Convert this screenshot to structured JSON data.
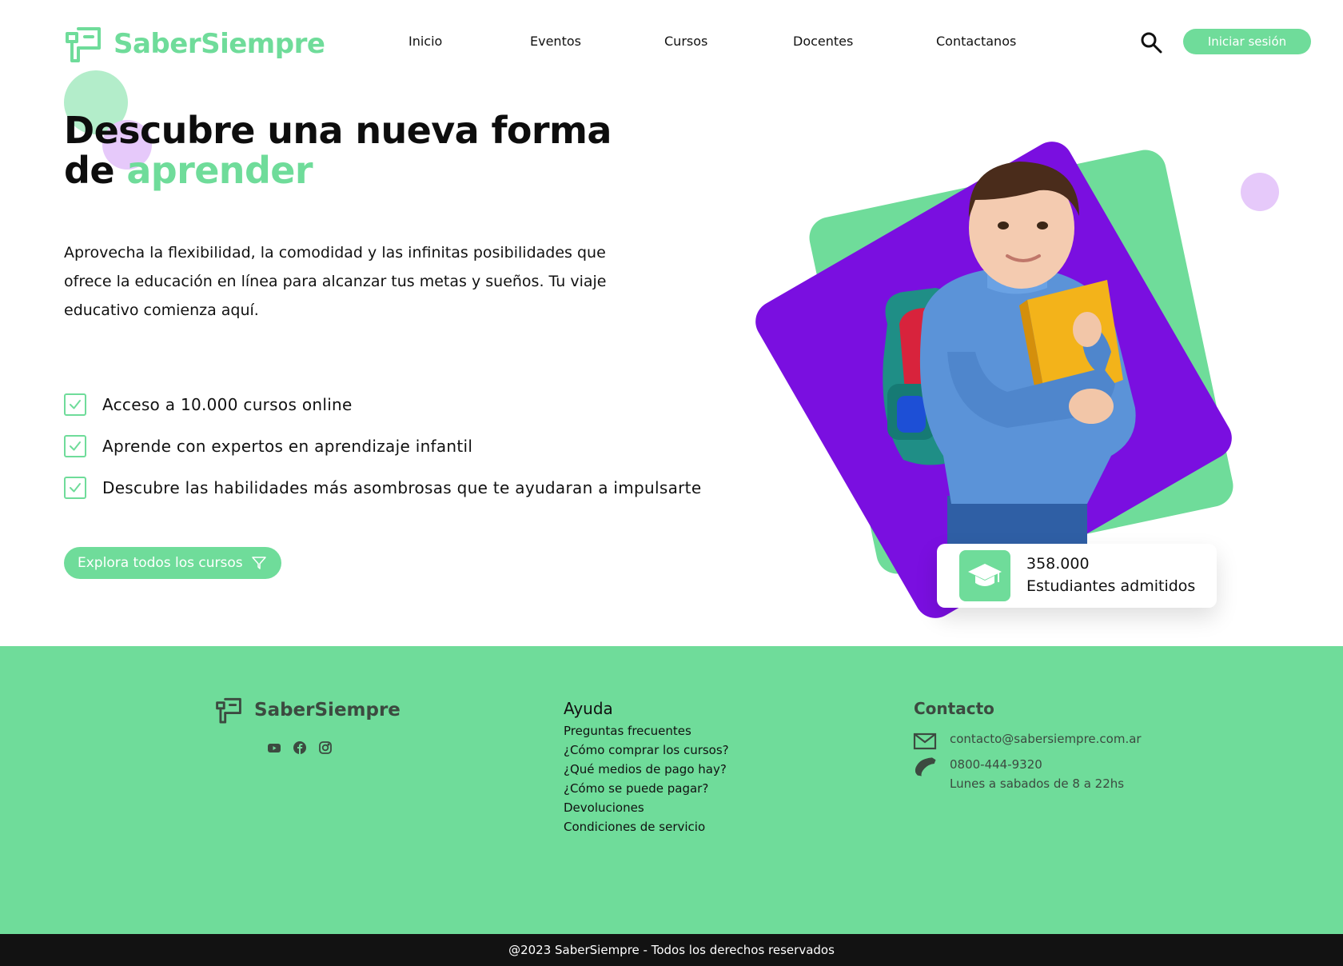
{
  "brand": {
    "name": "SaberSiempre",
    "accent_color": "#6fdc9a",
    "purple_color": "#7a0fe0"
  },
  "nav": {
    "items": [
      {
        "label": "Inicio"
      },
      {
        "label": "Eventos"
      },
      {
        "label": "Cursos"
      },
      {
        "label": "Docentes"
      },
      {
        "label": "Contactanos"
      }
    ],
    "search_icon": "search-icon",
    "login_label": "Iniciar sesión"
  },
  "hero": {
    "title_line1": "Descubre una nueva forma",
    "title_line2_prefix": "de ",
    "title_accent": "aprender",
    "description": "Aprovecha la flexibilidad, la comodidad y las infinitas posibilidades que ofrece la educación en línea para alcanzar tus metas y sueños. Tu viaje educativo comienza aquí.",
    "features": [
      {
        "text": "Acceso a 10.000 cursos online"
      },
      {
        "text": "Aprende con expertos en aprendizaje infantil"
      },
      {
        "text": "Descubre las habilidades más asombrosas que te ayudaran a impulsarte"
      }
    ],
    "cta_label": "Explora todos los cursos",
    "stat": {
      "number": "358.000",
      "label": "Estudiantes admitidos",
      "icon": "graduation-cap-icon"
    }
  },
  "footer": {
    "brand_name": "SaberSiempre",
    "socials": [
      "youtube-icon",
      "facebook-icon",
      "instagram-icon"
    ],
    "help": {
      "title": "Ayuda",
      "links": [
        {
          "label": "Preguntas frecuentes"
        },
        {
          "label": "¿Cómo comprar los cursos?"
        },
        {
          "label": "¿Qué medios de pago hay?"
        },
        {
          "label": "¿Cómo se puede pagar?"
        },
        {
          "label": "Devoluciones"
        },
        {
          "label": "Condiciones de servicio"
        }
      ]
    },
    "contact": {
      "title": "Contacto",
      "email": "contacto@sabersiempre.com.ar",
      "phone": "0800-444-9320",
      "hours": "Lunes a sabados de 8 a 22hs"
    },
    "copyright": "@2023 SaberSiempre - Todos los derechos reservados"
  }
}
